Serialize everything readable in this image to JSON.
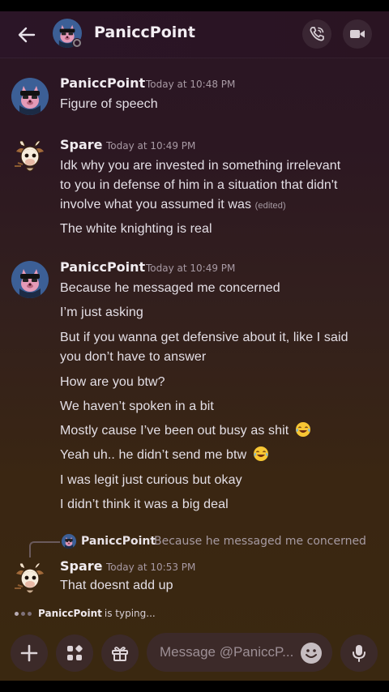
{
  "header": {
    "contact_name": "PaniccPoint",
    "chevron": "›",
    "icons": [
      "back-arrow-icon",
      "phone-call-icon",
      "video-camera-icon"
    ]
  },
  "messages": [
    {
      "author": "PaniccPoint",
      "timestamp": "Today at 10:48 PM",
      "avatar": "pink-panther-avatar",
      "lines": [
        "Figure of speech"
      ]
    },
    {
      "author": "Spare",
      "timestamp": "Today at 10:49 PM",
      "avatar": "goat-cartoon-avatar",
      "lines": [
        "Idk why you are invested in something irrelevant",
        "to you in defense of him in a situation that didn't",
        "involve what you assumed it was",
        "The white knighting is real"
      ],
      "edited_label": "(edited)"
    },
    {
      "author": "PaniccPoint",
      "timestamp": "Today at 10:49 PM",
      "avatar": "pink-panther-avatar",
      "lines": [
        "Because he messaged me concerned",
        "I’m just asking",
        "But if you wanna get defensive about it, like I said",
        "you don’t have to answer",
        "How are you btw?",
        "We haven’t spoken in a bit",
        "Mostly cause I’ve been out busy as shit",
        "Yeah uh.. he didn’t send me btw",
        "I was legit just curious but okay",
        "I didn’t think it was a big deal"
      ]
    },
    {
      "author": "Spare",
      "timestamp": "Today at 10:53 PM",
      "avatar": "goat-cartoon-avatar",
      "reply_to": {
        "author": "PaniccPoint",
        "text": "Because he messaged me concerned"
      },
      "lines": [
        "That doesnt add up"
      ]
    }
  ],
  "typing": {
    "user": "PaniccPoint",
    "text": "is typing..."
  },
  "composer": {
    "placeholder": "Message @PaniccP...",
    "icons": [
      "plus-icon",
      "apps-icon",
      "gift-icon",
      "emoji-icon",
      "microphone-icon"
    ]
  },
  "colors": {
    "header_bg": "#2b1527",
    "chat_bg_top": "#2a1624",
    "chat_bg_bottom": "#3a2810",
    "tool_bg": "#3c2a29",
    "timestamp": "#a89aa4"
  }
}
